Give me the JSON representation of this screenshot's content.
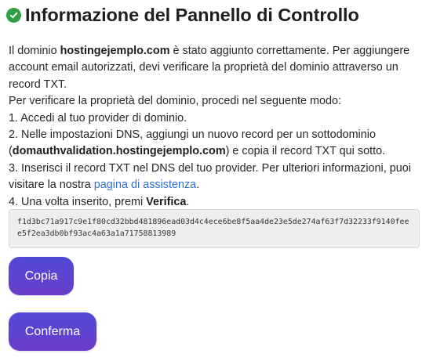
{
  "header": {
    "title": "Informazione del Pannello di Controllo",
    "icon": "check-circle-icon",
    "icon_color": "#2f9e44"
  },
  "body": {
    "line1_prefix": "Il dominio ",
    "domain": "hostingejemplo.com",
    "line1_suffix": " è stato aggiunto correttamente. Per aggiungere account email autorizzati, devi verificare la proprietà del dominio attraverso un record TXT.",
    "intro": "Per verificare la proprietà del dominio, procedi nel seguente modo:",
    "step1": "1. Accedi al tuo provider di dominio.",
    "step2_prefix": "2. Nelle impostazioni DNS, aggiungi un nuovo record per un sottodominio (",
    "subdomain": "domauthvalidation.hostingejemplo.com",
    "step2_suffix": ") e copia il record TXT qui sotto.",
    "step3_prefix": "3. Inserisci il record TXT nel DNS del tuo provider. Per ulteriori informazioni, puoi visitare la nostra ",
    "step3_link": "pagina di assistenza",
    "step3_suffix": ".",
    "step4_prefix": "4. Una volta inserito, premi ",
    "step4_bold": "Verifica",
    "step4_suffix": "."
  },
  "txt_record": "f1d3bc71a917c9e1f80cd32bbd481896ead03d4c4ece6be8f5aa4de23e5de274af63f7d32233f9140feee5f2ea3db0bf93ac4a63a1a71758813989",
  "buttons": {
    "copy_label": "Copia",
    "confirm_label": "Conferma"
  },
  "colors": {
    "link": "#2f6fd6",
    "button_gradient_start": "#4f4ad6",
    "button_gradient_end": "#6a3cc9",
    "code_background": "#eeeeee"
  }
}
